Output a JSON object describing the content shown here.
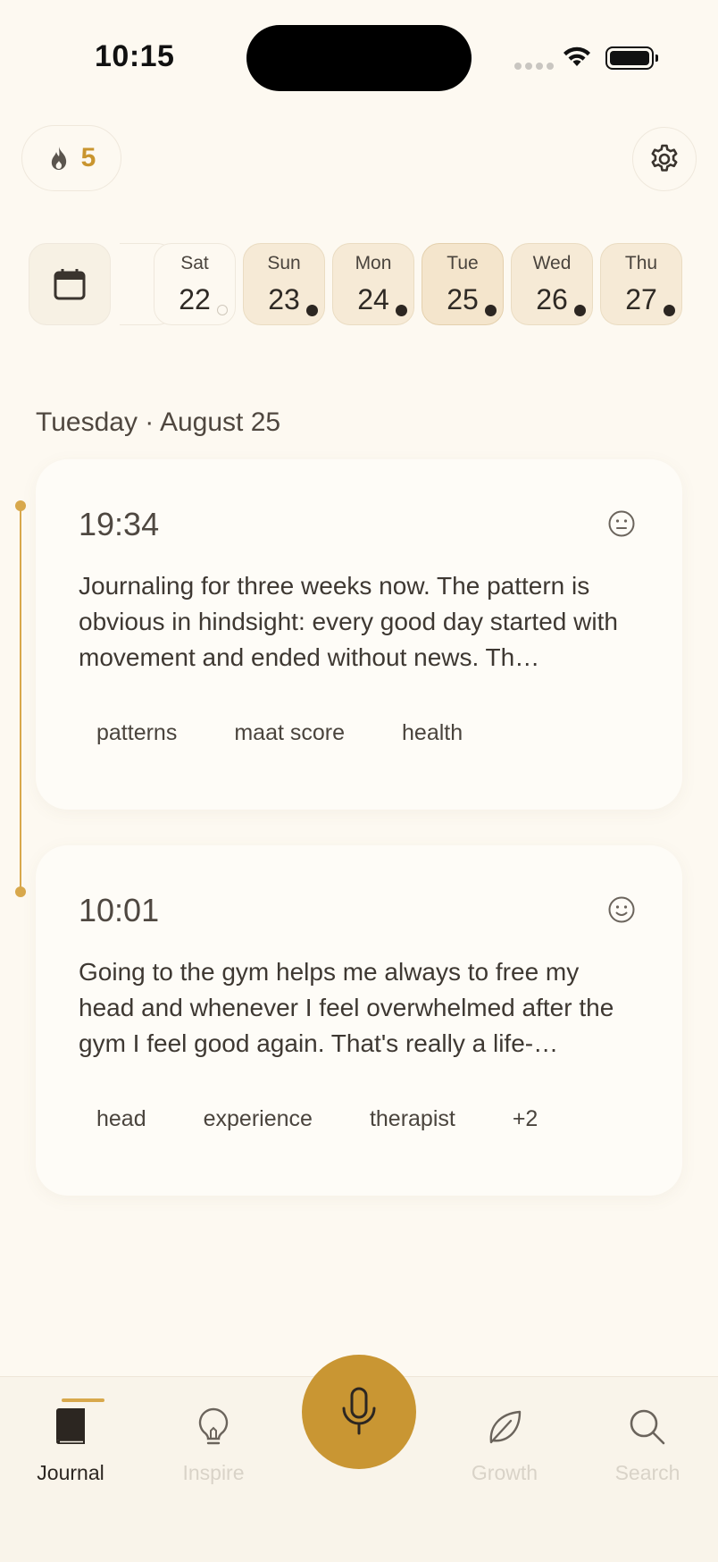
{
  "status_bar": {
    "time": "10:15"
  },
  "header": {
    "streak_count": "5",
    "streak_icon": "flame-icon",
    "settings_icon": "gear-icon"
  },
  "date_strip": {
    "calendar_icon": "calendar-icon",
    "days": [
      {
        "name": "Sat",
        "number": "22",
        "has_entry": false
      },
      {
        "name": "Sun",
        "number": "23",
        "has_entry": true
      },
      {
        "name": "Mon",
        "number": "24",
        "has_entry": true
      },
      {
        "name": "Tue",
        "number": "25",
        "has_entry": true,
        "selected": true
      },
      {
        "name": "Wed",
        "number": "26",
        "has_entry": true
      },
      {
        "name": "Thu",
        "number": "27",
        "has_entry": true
      }
    ]
  },
  "section": {
    "date_label": "Tuesday · August 25"
  },
  "entries": [
    {
      "time": "19:34",
      "mood": "neutral-face-icon",
      "text": "Journaling for three weeks now. The pattern is obvious in hindsight: every good day started with movement and ended without news. Th…",
      "tags": [
        "patterns",
        "maat score",
        "health"
      ]
    },
    {
      "time": "10:01",
      "mood": "smile-face-icon",
      "text": "Going to the gym helps me always to free my head and whenever I feel overwhelmed after the gym I feel good again. That's really a life-…",
      "tags": [
        "head",
        "experience",
        "therapist",
        "+2"
      ]
    }
  ],
  "nav": {
    "items": [
      {
        "label": "Journal",
        "icon": "book-icon",
        "active": true
      },
      {
        "label": "Inspire",
        "icon": "lightbulb-icon",
        "active": false
      },
      {
        "label": "Growth",
        "icon": "leaf-icon",
        "active": false
      },
      {
        "label": "Search",
        "icon": "search-icon",
        "active": false
      }
    ],
    "record_icon": "microphone-icon"
  },
  "colors": {
    "accent": "#c99633",
    "background": "#fdf9f1",
    "selected_day": "#f4e5cc"
  }
}
